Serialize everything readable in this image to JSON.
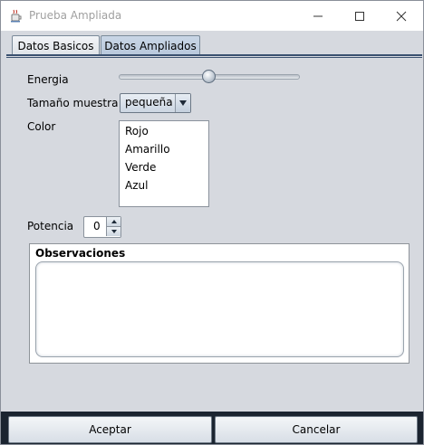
{
  "window": {
    "title": "Prueba Ampliada",
    "app_icon": "java-cup-icon",
    "controls": [
      "minimize-icon",
      "maximize-icon",
      "close-icon"
    ]
  },
  "tabs": [
    {
      "label": "Datos Basicos",
      "selected": false
    },
    {
      "label": "Datos Ampliados",
      "selected": true
    }
  ],
  "form": {
    "energia_label": "Energia",
    "energia_slider_fraction": 0.5,
    "tamano_label": "Tamaño muestra",
    "tamano_value": "pequeña",
    "color_label": "Color",
    "color_options": [
      "Rojo",
      "Amarillo",
      "Verde",
      "Azul"
    ],
    "potencia_label": "Potencia",
    "potencia_value": "0",
    "observaciones_label": "Observaciones",
    "observaciones_value": ""
  },
  "buttons": {
    "accept_label": "Aceptar",
    "cancel_label": "Cancelar"
  },
  "colors": {
    "accent": "#3b5170",
    "footer_bg": "#1b2430",
    "active_tab": "#b8c8dc"
  }
}
